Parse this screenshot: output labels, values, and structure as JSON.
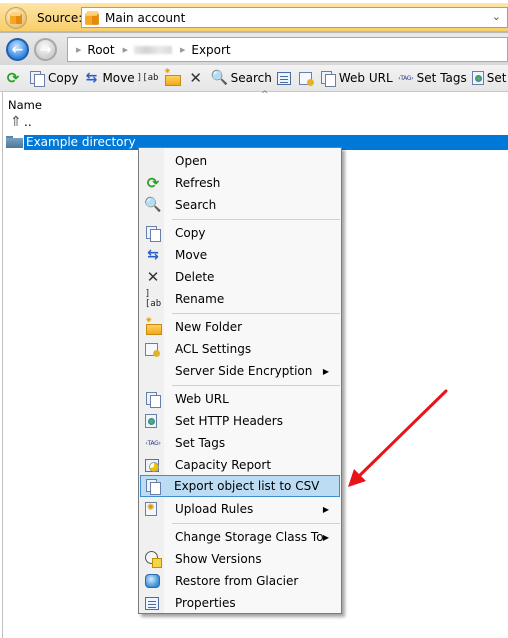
{
  "source_bar": {
    "label": "Source:",
    "selected_account": "Main account"
  },
  "nav": {
    "breadcrumb": [
      "Root",
      "(blurred)",
      "Export"
    ]
  },
  "toolbar": {
    "items": [
      {
        "icon": "refresh-icon",
        "label": ""
      },
      {
        "icon": "copy-icon",
        "label": "Copy"
      },
      {
        "icon": "move-icon",
        "label": "Move"
      },
      {
        "icon": "rename-icon",
        "label": ""
      },
      {
        "icon": "new-folder-icon",
        "label": ""
      },
      {
        "icon": "delete-icon",
        "label": ""
      },
      {
        "icon": "search-icon",
        "label": "Search"
      },
      {
        "icon": "properties-icon",
        "label": ""
      },
      {
        "icon": "acl-settings-icon",
        "label": ""
      },
      {
        "icon": "web-url-icon",
        "label": "Web URL"
      },
      {
        "icon": "tag-icon",
        "label": "Set Tags"
      },
      {
        "icon": "http-headers-icon",
        "label": "Set HTTP Headers"
      }
    ]
  },
  "file_list": {
    "column_name": "Name",
    "rows": [
      {
        "name": "..",
        "icon": "parent-up-icon",
        "selected": false
      },
      {
        "name": "Example directory",
        "icon": "folder-icon",
        "selected": true
      }
    ]
  },
  "context_menu": {
    "items": [
      {
        "label": "Open",
        "icon": "",
        "submenu": false
      },
      {
        "label": "Refresh",
        "icon": "refresh-icon",
        "submenu": false
      },
      {
        "label": "Search",
        "icon": "search-icon",
        "submenu": false
      },
      {
        "separator": true
      },
      {
        "label": "Copy",
        "icon": "copy-icon",
        "submenu": false
      },
      {
        "label": "Move",
        "icon": "move-icon",
        "submenu": false
      },
      {
        "label": "Delete",
        "icon": "delete-icon",
        "submenu": false
      },
      {
        "label": "Rename",
        "icon": "rename-icon",
        "submenu": false
      },
      {
        "separator": true
      },
      {
        "label": "New Folder",
        "icon": "new-folder-icon",
        "submenu": false
      },
      {
        "label": "ACL Settings",
        "icon": "acl-settings-icon",
        "submenu": false
      },
      {
        "label": "Server Side Encryption",
        "icon": "",
        "submenu": true
      },
      {
        "separator": true
      },
      {
        "label": "Web URL",
        "icon": "web-url-icon",
        "submenu": false
      },
      {
        "label": "Set HTTP Headers",
        "icon": "http-headers-icon",
        "submenu": false
      },
      {
        "label": "Set Tags",
        "icon": "tag-icon",
        "submenu": false
      },
      {
        "label": "Capacity Report",
        "icon": "capacity-report-icon",
        "submenu": false
      },
      {
        "label": "Export object list to CSV",
        "icon": "export-csv-icon",
        "submenu": false,
        "highlighted": true
      },
      {
        "label": "Upload Rules",
        "icon": "upload-rules-icon",
        "submenu": true
      },
      {
        "separator": true
      },
      {
        "label": "Change Storage Class To",
        "icon": "",
        "submenu": true
      },
      {
        "label": "Show Versions",
        "icon": "versions-icon",
        "submenu": false
      },
      {
        "label": "Restore from Glacier",
        "icon": "glacier-icon",
        "submenu": false
      },
      {
        "label": "Properties",
        "icon": "properties-icon",
        "submenu": false
      }
    ]
  },
  "glyphs": {
    "refresh": "⟳",
    "move": "⇆",
    "rename": "][ab",
    "delete": "✕",
    "search": "🔍",
    "tag": "‹TAG›",
    "up": "⇑",
    "back": "←",
    "forward": "→",
    "chevron_down": "⌄",
    "crumb_sep": "▶",
    "submenu_arrow": "▶",
    "sort_caret": "^"
  },
  "colors": {
    "selection": "#0078d7",
    "menu_highlight": "#bcdcf4",
    "menu_highlight_border": "#3d8fd0",
    "source_bar": "#f9cf6b",
    "annotation_arrow": "#e8141a"
  }
}
